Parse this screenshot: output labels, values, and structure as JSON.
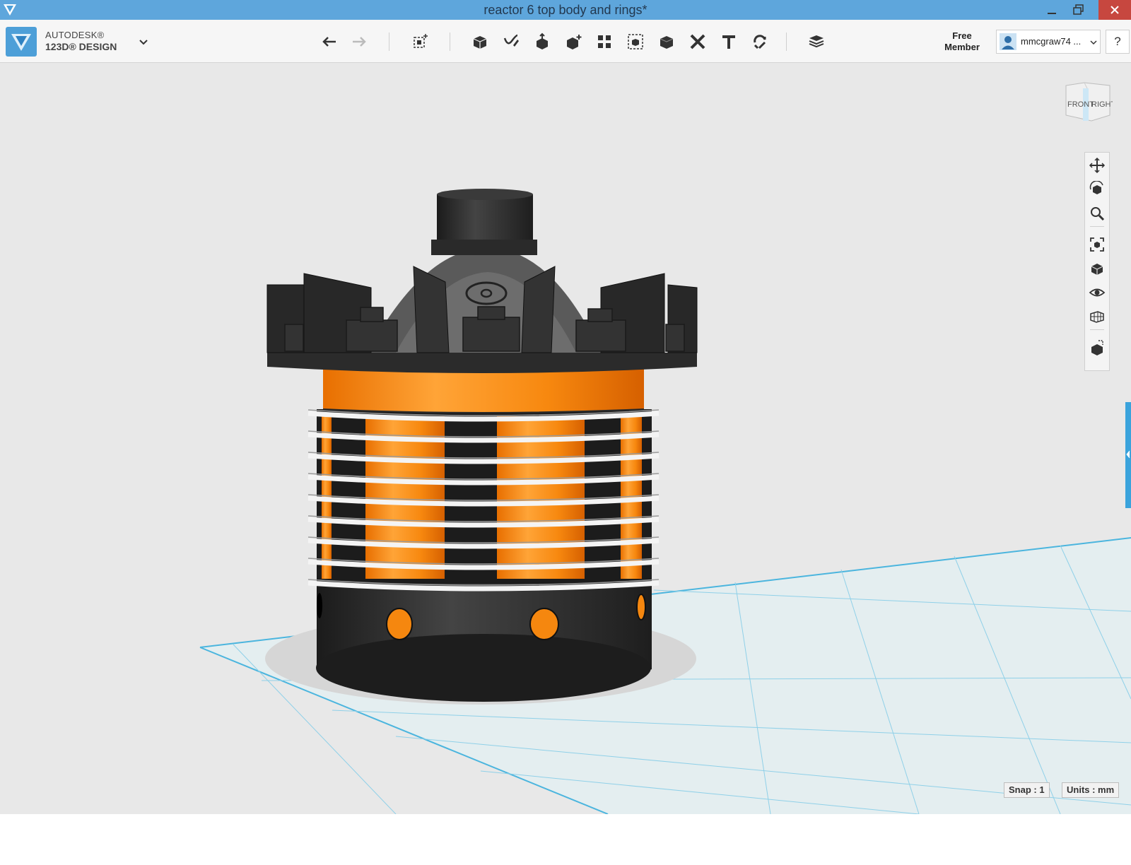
{
  "window": {
    "title": "reactor 6 top body and rings*"
  },
  "brand": {
    "line1": "AUTODESK®",
    "line2": "123D® DESIGN"
  },
  "toolbar": {
    "icons": [
      "undo-icon",
      "redo-icon",
      "transform-icon",
      "primitives-icon",
      "sketch-icon",
      "construct-icon",
      "modify-icon",
      "pattern-icon",
      "group-icon",
      "combine-icon",
      "measure-icon",
      "text-icon",
      "snap-icon",
      "materials-icon"
    ]
  },
  "account": {
    "membership": "Free\nMember",
    "username": "mmcgraw74 ...",
    "help": "?"
  },
  "viewcube": {
    "front": "FRONT",
    "right": "RIGHT"
  },
  "status": {
    "snap": "Snap : 1",
    "units": "Units : mm"
  }
}
